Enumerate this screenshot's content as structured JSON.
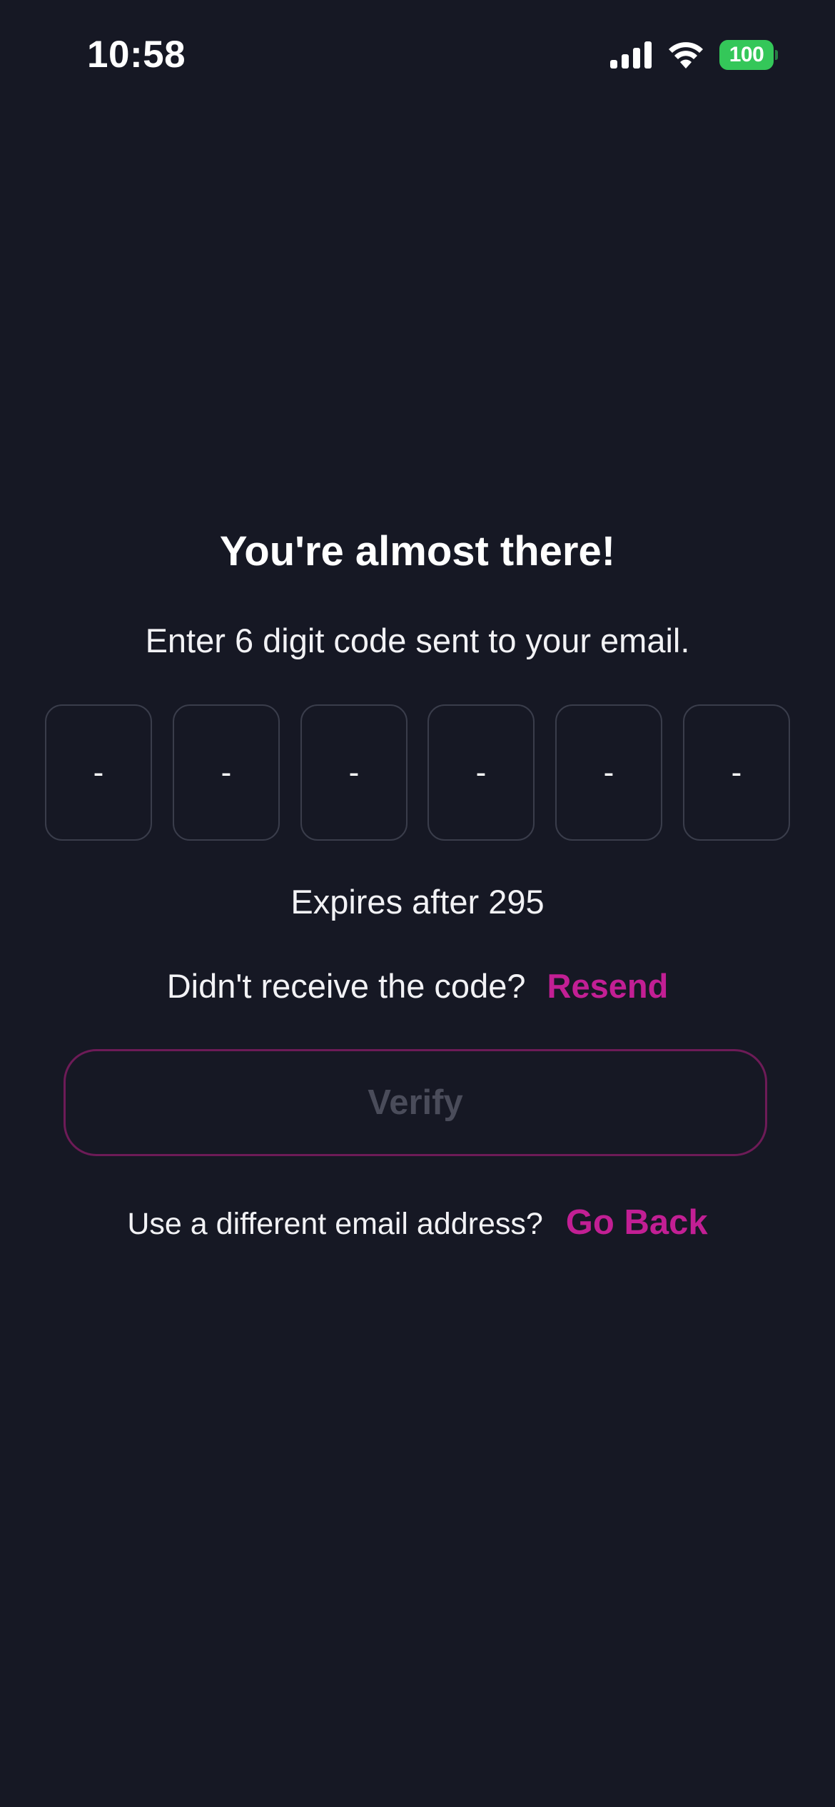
{
  "status_bar": {
    "time": "10:58",
    "battery_level": "100",
    "icons": [
      "signal-icon",
      "wifi-icon",
      "battery-icon"
    ]
  },
  "screen": {
    "title": "You're almost there!",
    "instruction": "Enter 6 digit code sent to your email.",
    "code_digits": [
      "-",
      "-",
      "-",
      "-",
      "-",
      "-"
    ],
    "expires_text": "Expires after 295",
    "resend_prompt": "Didn't receive the code?",
    "resend_label": "Resend",
    "verify_label": "Verify",
    "back_prompt": "Use a different email address?",
    "back_label": "Go Back"
  },
  "colors": {
    "background": "#161824",
    "accent": "#c21f94",
    "verify_border": "#6d1b57",
    "verify_text_disabled": "#4a4c5a",
    "code_box_border": "#3a3d4b",
    "battery_green": "#34c759"
  }
}
